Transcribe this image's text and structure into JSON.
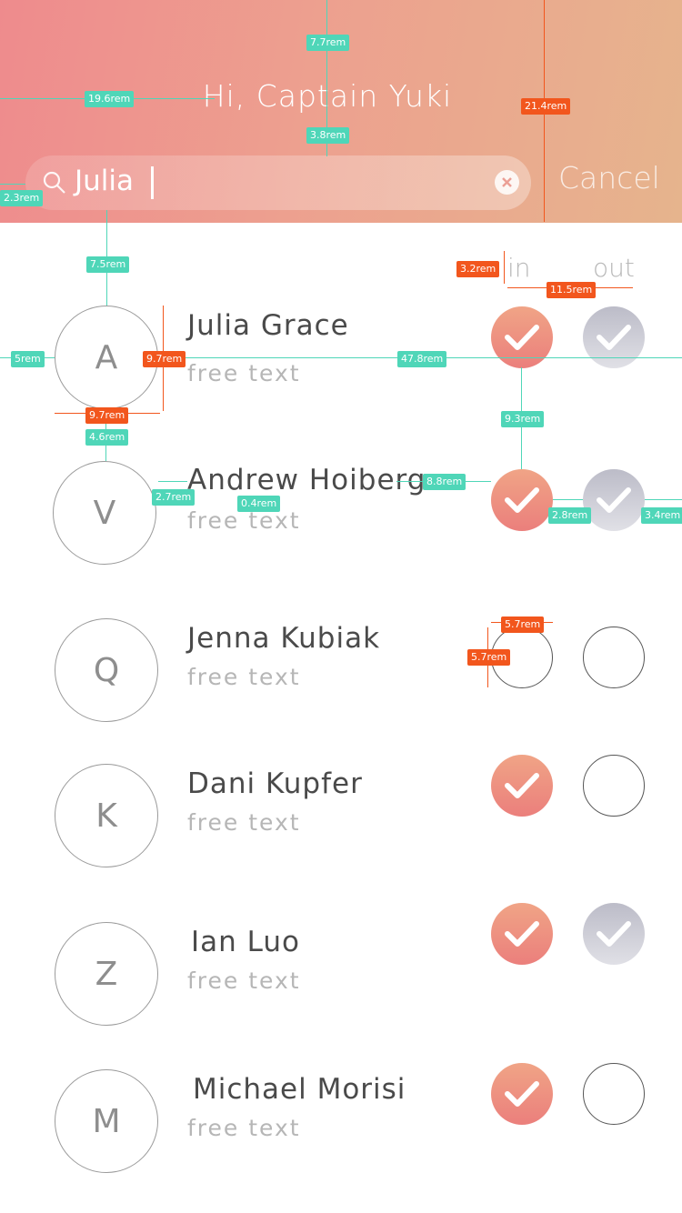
{
  "header": {
    "greeting": "Hi, Captain Yuki",
    "search_value": "Julia",
    "cancel_label": "Cancel",
    "search_icon": "search-icon",
    "clear_icon": "clear-icon"
  },
  "columns": {
    "in_label": "in",
    "out_label": "out"
  },
  "contacts": [
    {
      "initial": "A",
      "name": "Julia Grace",
      "subtitle": "free text",
      "in": true,
      "out": true
    },
    {
      "initial": "V",
      "name": "Andrew Hoiberg",
      "subtitle": "free text",
      "in": true,
      "out": true
    },
    {
      "initial": "Q",
      "name": "Jenna Kubiak",
      "subtitle": "free text",
      "in": false,
      "out": false
    },
    {
      "initial": "K",
      "name": "Dani Kupfer",
      "subtitle": "free text",
      "in": true,
      "out": false
    },
    {
      "initial": "Z",
      "name": "Ian Luo",
      "subtitle": "free text",
      "in": true,
      "out": true
    },
    {
      "initial": "M",
      "name": "Michael Morisi",
      "subtitle": "free text",
      "in": true,
      "out": false
    }
  ],
  "annotations": {
    "a1": "7.7rem",
    "a2": "19.6rem",
    "a3": "3.8rem",
    "a4": "21.4rem",
    "a5": "2.3rem",
    "a6": "7.5rem",
    "a7": "3.2rem",
    "a8": "11.5rem",
    "a9": "5rem",
    "a10": "9.7rem",
    "a11": "47.8rem",
    "a12": "9.7rem",
    "a13": "4.6rem",
    "a14": "9.3rem",
    "a15": "2.7rem",
    "a16": "0.4rem",
    "a17": "8.8rem",
    "a18": "2.8rem",
    "a19": "3.4rem",
    "a20": "5.7rem",
    "a21": "5.7rem"
  },
  "colors": {
    "header_start": "#ee8b8d",
    "header_end": "#e6b48d",
    "check_in": "#eb7f7c",
    "check_out": "#bcbcc8",
    "measure_teal": "#4fd6b8",
    "measure_orange": "#f2561d"
  }
}
